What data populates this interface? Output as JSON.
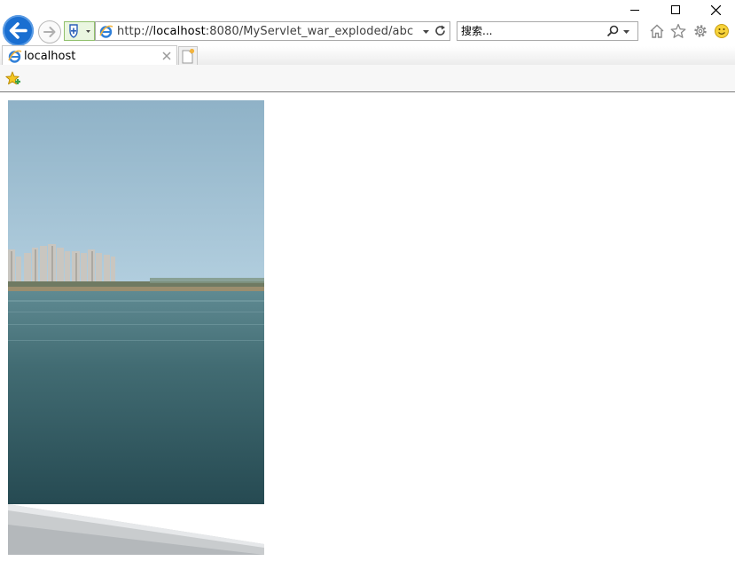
{
  "window": {
    "minimize_icon": "minimize-icon",
    "maximize_icon": "maximize-icon",
    "close_icon": "close-icon"
  },
  "nav": {
    "address_prefix": "http://",
    "address_host": "localhost",
    "address_rest": ":8080/MyServlet_war_exploded/abc",
    "search_placeholder": "搜索..."
  },
  "tab": {
    "title": "localhost"
  },
  "colors": {
    "back_button": "#1a6fd1",
    "security_green": "#8fbf6a",
    "ie_blue": "#2f7fd8"
  },
  "content": {
    "image": "lake-with-city-skyline-photo"
  }
}
